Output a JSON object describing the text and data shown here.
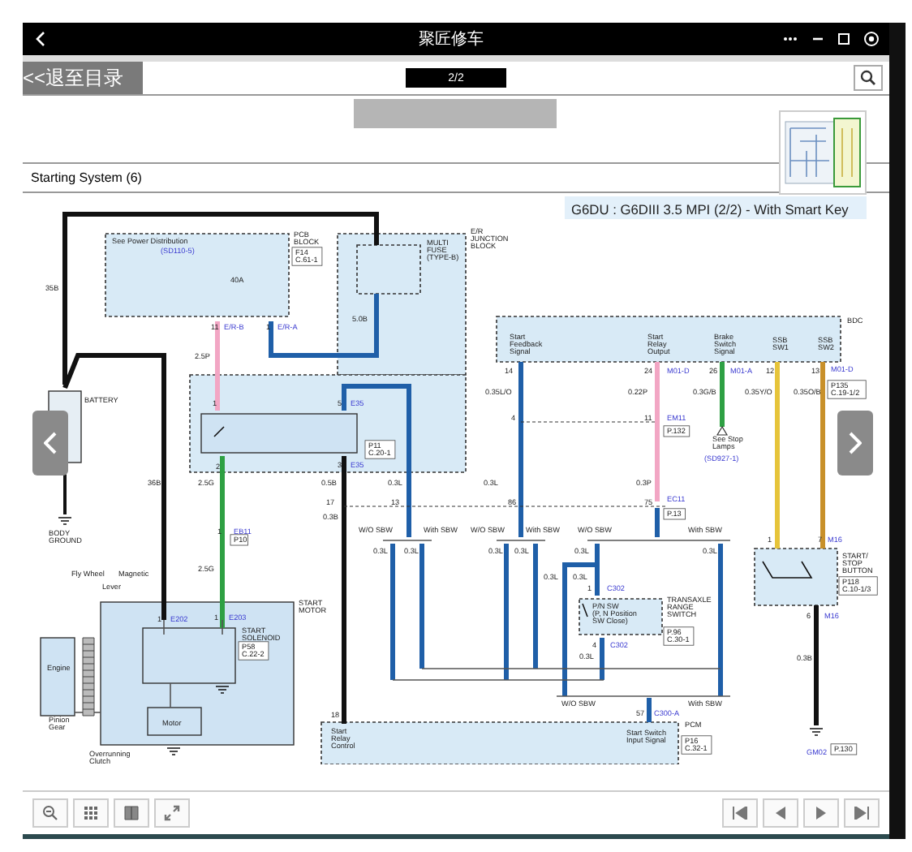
{
  "header": {
    "title": "聚匠修车"
  },
  "toolbar": {
    "back_label": "<<退至目录",
    "page": "2/2"
  },
  "section_title": "Starting System (6)",
  "diagram": {
    "title": "G6DU : G6DIII 3.5 MPI (2/2) - With Smart Key",
    "labels": [
      {
        "text": "See Power Distribution",
        "kind": "note"
      },
      {
        "text": "(SD110-5)",
        "kind": "pin"
      },
      {
        "lines": [
          "PCB",
          "BLOCK"
        ],
        "kind": "note"
      },
      {
        "lines": [
          "F14",
          "C.61-1"
        ],
        "kind": "ref"
      },
      {
        "text": "40A",
        "kind": "note"
      },
      {
        "lines": [
          "MULTI",
          "FUSE",
          "(TYPE-B)"
        ],
        "kind": "note"
      },
      {
        "lines": [
          "E/R",
          "JUNCTION",
          "BLOCK"
        ],
        "kind": "note"
      },
      {
        "text": "35B",
        "kind": "note"
      },
      {
        "text": "11",
        "kind": "note"
      },
      {
        "text": "E/R-B",
        "kind": "pin"
      },
      {
        "text": "1",
        "kind": "note"
      },
      {
        "text": "E/R-A",
        "kind": "pin"
      },
      {
        "text": "5.0B",
        "kind": "note"
      },
      {
        "text": "2.5P",
        "kind": "note"
      },
      {
        "text": "BATTERY",
        "kind": "note"
      },
      {
        "text": "1",
        "kind": "note"
      },
      {
        "text": "5",
        "kind": "note"
      },
      {
        "text": "E35",
        "kind": "pin"
      },
      {
        "lines": [
          "P11",
          "C.20-1"
        ],
        "kind": "ref"
      },
      {
        "text": "2",
        "kind": "note"
      },
      {
        "text": "3",
        "kind": "note"
      },
      {
        "text": "E35",
        "kind": "pin"
      },
      {
        "text": "36B",
        "kind": "note"
      },
      {
        "text": "2.5G",
        "kind": "note"
      },
      {
        "text": "0.5B",
        "kind": "note"
      },
      {
        "text": "0.3L",
        "kind": "note"
      },
      {
        "text": "17",
        "kind": "note"
      },
      {
        "text": "0.3B",
        "kind": "note"
      },
      {
        "text": "13",
        "kind": "note"
      },
      {
        "lines": [
          "BODY",
          "GROUND"
        ],
        "kind": "note"
      },
      {
        "text": "1",
        "kind": "note"
      },
      {
        "text": "EB11",
        "kind": "pin"
      },
      {
        "lines": [
          "P10"
        ],
        "kind": "ref"
      },
      {
        "text": "2.5G",
        "kind": "note"
      },
      {
        "text": "Fly Wheel",
        "kind": "note"
      },
      {
        "text": "Magnetic",
        "kind": "note"
      },
      {
        "text": "Lever",
        "kind": "note"
      },
      {
        "lines": [
          "START",
          "MOTOR"
        ],
        "kind": "note"
      },
      {
        "text": "1",
        "kind": "note"
      },
      {
        "text": "E202",
        "kind": "pin"
      },
      {
        "text": "1",
        "kind": "note"
      },
      {
        "text": "E203",
        "kind": "pin"
      },
      {
        "lines": [
          "START",
          "SOLENOID"
        ],
        "kind": "note"
      },
      {
        "lines": [
          "P58",
          "C.22-2"
        ],
        "kind": "ref"
      },
      {
        "text": "Engine",
        "kind": "note"
      },
      {
        "lines": [
          "Pinion",
          "Gear"
        ],
        "kind": "note"
      },
      {
        "text": "Motor",
        "kind": "note"
      },
      {
        "lines": [
          "Overrunning",
          "Clutch"
        ],
        "kind": "note"
      },
      {
        "text": "18",
        "kind": "note"
      },
      {
        "lines": [
          "Start",
          "Relay",
          "Control"
        ],
        "kind": "note"
      },
      {
        "text": "W/O SBW",
        "kind": "note"
      },
      {
        "text": "With SBW",
        "kind": "note"
      },
      {
        "text": "0.3L",
        "kind": "note"
      },
      {
        "text": "0.3L",
        "kind": "note"
      },
      {
        "text": "BDC",
        "kind": "note"
      },
      {
        "lines": [
          "Start",
          "Feedback",
          "Signal"
        ],
        "kind": "note"
      },
      {
        "lines": [
          "Start",
          "Relay",
          "Output"
        ],
        "kind": "note"
      },
      {
        "lines": [
          "Brake",
          "Switch",
          "Signal"
        ],
        "kind": "note"
      },
      {
        "lines": [
          "SSB",
          "SW1"
        ],
        "kind": "note"
      },
      {
        "lines": [
          "SSB",
          "SW2"
        ],
        "kind": "note"
      },
      {
        "text": "14",
        "kind": "note"
      },
      {
        "text": "24",
        "kind": "note"
      },
      {
        "text": "M01-D",
        "kind": "pin"
      },
      {
        "text": "26",
        "kind": "note"
      },
      {
        "text": "M01-A",
        "kind": "pin"
      },
      {
        "text": "12",
        "kind": "note"
      },
      {
        "text": "13",
        "kind": "note"
      },
      {
        "text": "M01-D",
        "kind": "pin"
      },
      {
        "text": "0.35L/O",
        "kind": "note"
      },
      {
        "text": "0.22P",
        "kind": "note"
      },
      {
        "text": "0.3G/B",
        "kind": "note"
      },
      {
        "text": "0.35Y/O",
        "kind": "note"
      },
      {
        "text": "0.35O/B",
        "kind": "note"
      },
      {
        "lines": [
          "P135",
          "C.19-1/2"
        ],
        "kind": "ref"
      },
      {
        "text": "4",
        "kind": "note"
      },
      {
        "text": "11",
        "kind": "note"
      },
      {
        "text": "EM11",
        "kind": "pin"
      },
      {
        "lines": [
          "P.132"
        ],
        "kind": "ref"
      },
      {
        "lines": [
          "See Stop",
          "Lamps"
        ],
        "kind": "note"
      },
      {
        "text": "(SD927-1)",
        "kind": "pin"
      },
      {
        "text": "0.3L",
        "kind": "note"
      },
      {
        "text": "0.3P",
        "kind": "note"
      },
      {
        "text": "86",
        "kind": "note"
      },
      {
        "text": "75",
        "kind": "note"
      },
      {
        "text": "EC11",
        "kind": "pin"
      },
      {
        "lines": [
          "P.13"
        ],
        "kind": "ref"
      },
      {
        "text": "W/O SBW",
        "kind": "note"
      },
      {
        "text": "With SBW",
        "kind": "note"
      },
      {
        "text": "W/O SBW",
        "kind": "note"
      },
      {
        "text": "With SBW",
        "kind": "note"
      },
      {
        "text": "0.3L",
        "kind": "note"
      },
      {
        "text": "0.3L",
        "kind": "note"
      },
      {
        "text": "0.3L",
        "kind": "note"
      },
      {
        "text": "0.3L",
        "kind": "note"
      },
      {
        "text": "0.3L",
        "kind": "note"
      },
      {
        "text": "0.3L",
        "kind": "note"
      },
      {
        "text": "1",
        "kind": "note"
      },
      {
        "text": "C302",
        "kind": "pin"
      },
      {
        "lines": [
          "P/N SW",
          "(P, N Position",
          "SW Close)"
        ],
        "kind": "note"
      },
      {
        "lines": [
          "TRANSAXLE",
          "RANGE",
          "SWITCH"
        ],
        "kind": "note"
      },
      {
        "lines": [
          "P.96",
          "C.30-1"
        ],
        "kind": "ref"
      },
      {
        "text": "4",
        "kind": "note"
      },
      {
        "text": "C302",
        "kind": "pin"
      },
      {
        "text": "0.3L",
        "kind": "note"
      },
      {
        "text": "W/O SBW",
        "kind": "note"
      },
      {
        "text": "With SBW",
        "kind": "note"
      },
      {
        "text": "57",
        "kind": "note"
      },
      {
        "text": "C300-A",
        "kind": "pin"
      },
      {
        "text": "PCM",
        "kind": "note"
      },
      {
        "lines": [
          "P16",
          "C.32-1"
        ],
        "kind": "ref"
      },
      {
        "lines": [
          "Start Switch",
          "Input Signal"
        ],
        "kind": "note"
      },
      {
        "text": "1",
        "kind": "note"
      },
      {
        "text": "7",
        "kind": "note"
      },
      {
        "text": "M16",
        "kind": "pin"
      },
      {
        "lines": [
          "START/",
          "STOP",
          "BUTTON"
        ],
        "kind": "note"
      },
      {
        "lines": [
          "P118",
          "C.10-1/3"
        ],
        "kind": "ref"
      },
      {
        "text": "6",
        "kind": "note"
      },
      {
        "text": "M16",
        "kind": "pin"
      },
      {
        "text": "0.3B",
        "kind": "note"
      },
      {
        "text": "GM02",
        "kind": "pin"
      },
      {
        "lines": [
          "P.130"
        ],
        "kind": "ref"
      }
    ]
  }
}
